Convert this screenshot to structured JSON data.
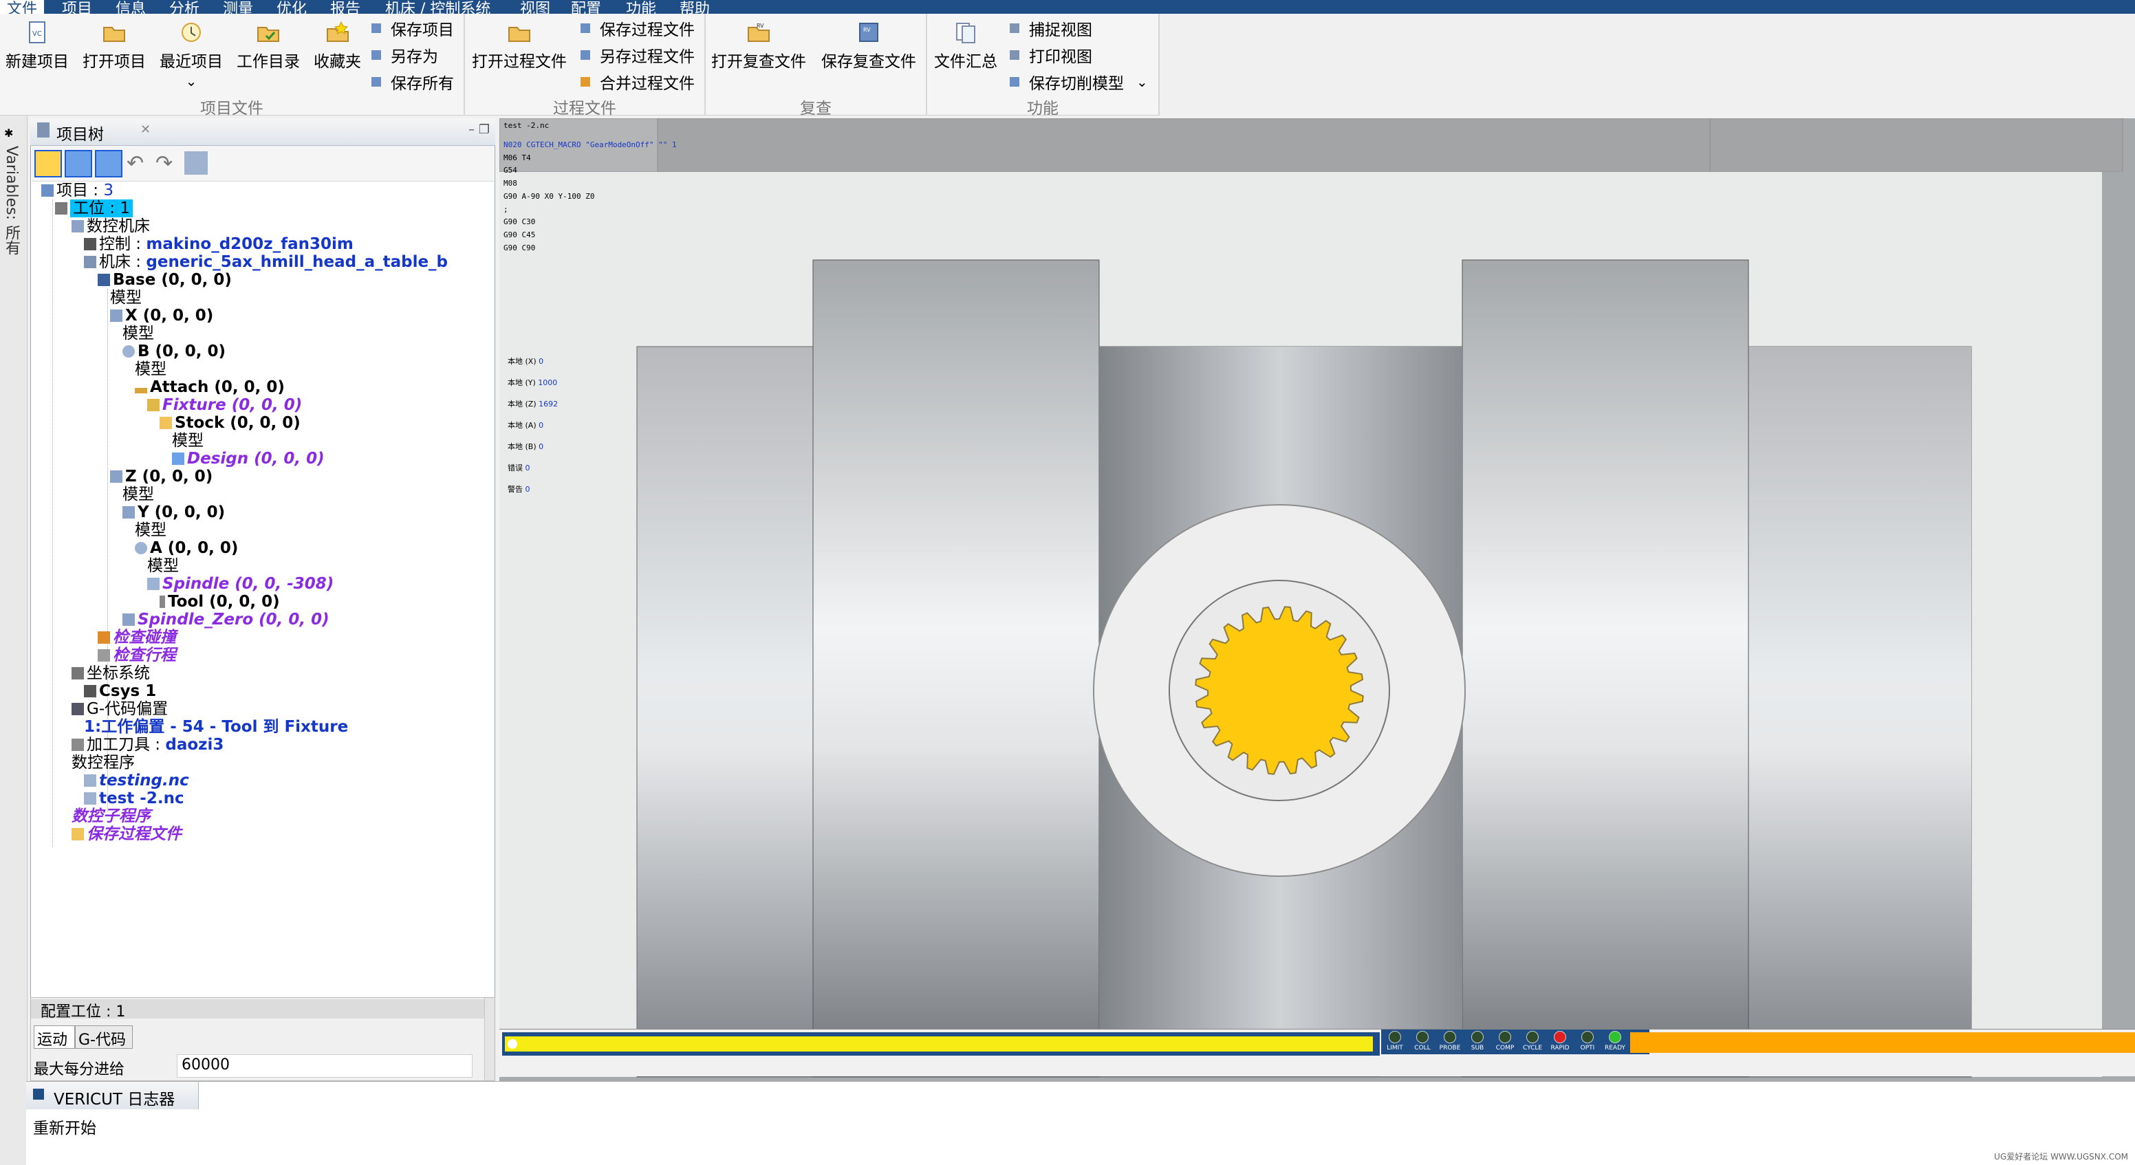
{
  "menubar": {
    "items": [
      "文件",
      "项目",
      "信息",
      "分析",
      "测量",
      "优化",
      "报告",
      "机床 / 控制系统",
      "视图",
      "配置",
      "功能",
      "帮助"
    ]
  },
  "ribbon": {
    "project_group": {
      "label": "项目文件",
      "new_project": "新建项目",
      "open_project": "打开项目",
      "recent_project": "最近项目",
      "work_dir": "工作目录",
      "favorites": "收藏夹",
      "save_project": "保存项目",
      "save_as": "另存为",
      "save_all": "保存所有"
    },
    "process_group": {
      "label": "过程文件",
      "open_process": "打开过程文件",
      "save_process": "保存过程文件",
      "save_process_as": "另存过程文件",
      "merge_process": "合并过程文件"
    },
    "review_group": {
      "label": "复查",
      "open_review": "打开复查文件",
      "save_review": "保存复查文件"
    },
    "function_group": {
      "label": "功能",
      "file_summary": "文件汇总",
      "capture_view": "捕捉视图",
      "print_view": "打印视图",
      "save_cut_model": "保存切削模型"
    }
  },
  "side_tab": {
    "variables": "Variables: 所有"
  },
  "tree": {
    "tab_title": "项目树",
    "items": [
      {
        "prefix": "项目 : ",
        "value": "3"
      },
      {
        "prefix": "工位 : ",
        "value": "1"
      },
      {
        "text": "数控机床"
      },
      {
        "prefix": "控制 : ",
        "value": "makino_d200z_fan30im"
      },
      {
        "prefix": "机床 : ",
        "value": "generic_5ax_hmill_head_a_table_b"
      },
      {
        "text": "Base (0, 0, 0)"
      },
      {
        "text": "模型"
      },
      {
        "text": "X (0, 0, 0)"
      },
      {
        "text": "模型"
      },
      {
        "text": "B (0, 0, 0)"
      },
      {
        "text": "模型"
      },
      {
        "text": "Attach (0, 0, 0)"
      },
      {
        "text": "Fixture (0, 0, 0)"
      },
      {
        "text": "Stock (0, 0, 0)"
      },
      {
        "text": "模型"
      },
      {
        "text": "Design (0, 0, 0)"
      },
      {
        "text": "Z (0, 0, 0)"
      },
      {
        "text": "模型"
      },
      {
        "text": "Y (0, 0, 0)"
      },
      {
        "text": "模型"
      },
      {
        "text": "A (0, 0, 0)"
      },
      {
        "text": "模型"
      },
      {
        "text": "Spindle (0, 0, -308)"
      },
      {
        "text": "Tool (0, 0, 0)"
      },
      {
        "text": "Spindle_Zero (0, 0, 0)"
      },
      {
        "text": "检查碰撞"
      },
      {
        "text": "检查行程"
      },
      {
        "text": "坐标系统"
      },
      {
        "text": "Csys 1"
      },
      {
        "text": "G-代码偏置"
      },
      {
        "text": "1:工作偏置 - 54 - Tool 到 Fixture"
      },
      {
        "prefix": "加工刀具 : ",
        "value": "daozi3"
      },
      {
        "text": "数控程序"
      },
      {
        "text": "testing.nc"
      },
      {
        "text": "test -2.nc"
      },
      {
        "text": "数控子程序"
      },
      {
        "text": "保存过程文件"
      }
    ]
  },
  "config": {
    "title": "配置工位 : 1",
    "tab_motion": "运动",
    "tab_gcode": "G-代码",
    "feed_label": "最大每分进给",
    "feed_value": "60000"
  },
  "viewport": {
    "filename": "test -2.nc",
    "gcode_lines": [
      "N020 CGTECH_MACRO \"GearModeOnOff\" \"\" 1",
      "M06 T4",
      "G54",
      "M08",
      "G90 A-90 X0 Y-100 Z0",
      ";",
      "G90 C30",
      "G90 C45",
      "G90 C90"
    ],
    "readouts": [
      {
        "label": "本地 (X)",
        "value": "0"
      },
      {
        "label": "本地 (Y)",
        "value": "1000"
      },
      {
        "label": "本地 (Z)",
        "value": "1692"
      },
      {
        "label": "本地 (A)",
        "value": "0"
      },
      {
        "label": "本地 (B)",
        "value": "0"
      },
      {
        "label": "错误",
        "value": "0"
      },
      {
        "label": "警告",
        "value": "0"
      }
    ],
    "indicators": [
      "LIMIT",
      "COLL",
      "PROBE",
      "SUB",
      "COMP",
      "CYCLE",
      "RAPID",
      "OPTI",
      "READY"
    ]
  },
  "log": {
    "title": "VERICUT 日志器",
    "message": "重新开始"
  },
  "watermark": "UG爱好者论坛 WWW.UGSNX.COM",
  "colors": {
    "menubar": "#1f4e86",
    "gear": "#ffc90e",
    "progress": "#f7ec13",
    "progress_right": "#ffa500",
    "selected": "#00bfff"
  }
}
